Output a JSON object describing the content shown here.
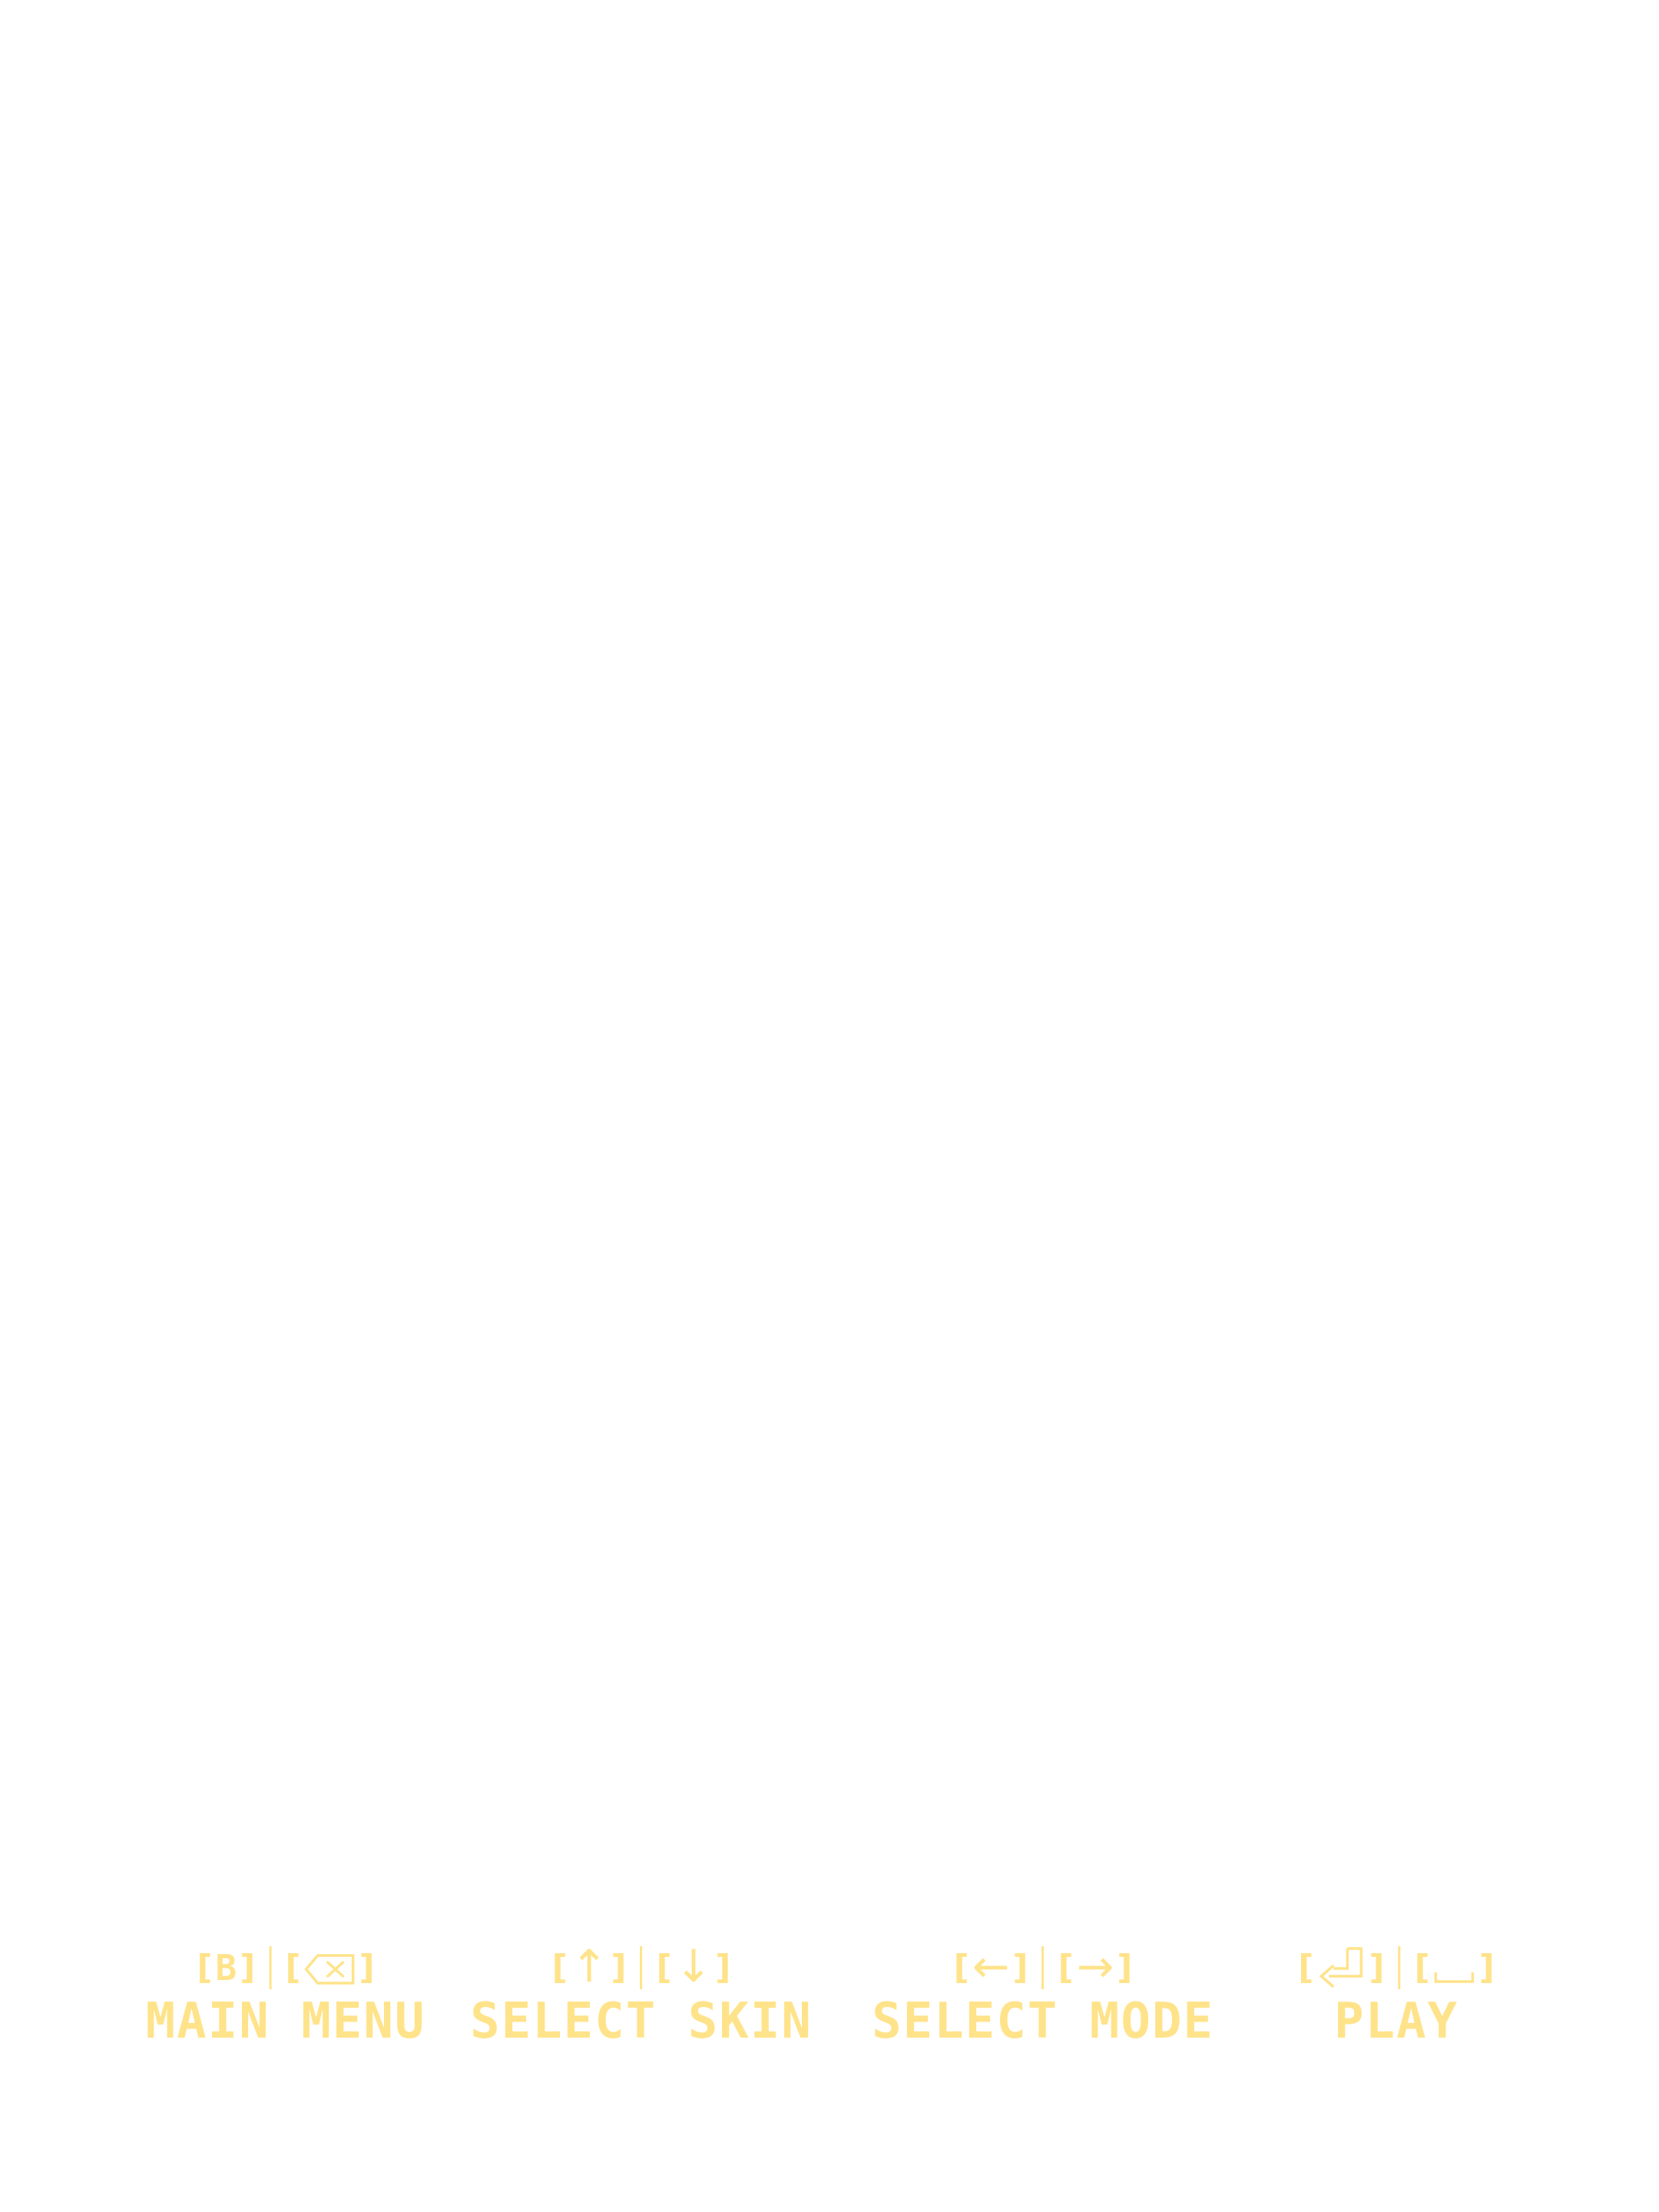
{
  "theme": {
    "background": "#ffffff",
    "accent": "#ffe38a"
  },
  "controls": {
    "main_menu": {
      "key1": "B",
      "key2_icon": "backspace-icon",
      "label": "MAIN MENU"
    },
    "select_skin": {
      "key1_icon": "arrow-up-icon",
      "key1": "↑",
      "key2_icon": "arrow-down-icon",
      "key2": "↓",
      "label": "SELECT SKIN"
    },
    "select_mode": {
      "key1_icon": "arrow-left-icon",
      "key1": "←",
      "key2_icon": "arrow-right-icon",
      "key2": "→",
      "label": "SELECT MODE"
    },
    "play": {
      "key1_icon": "enter-icon",
      "key2_icon": "space-icon",
      "label": "PLAY"
    }
  }
}
